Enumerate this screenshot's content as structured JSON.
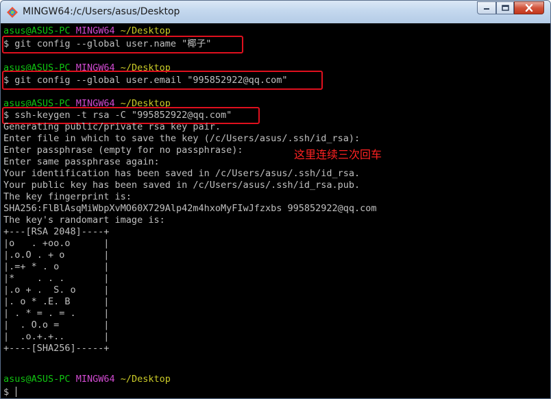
{
  "window": {
    "title": "MINGW64:/c/Users/asus/Desktop",
    "icon": "git-bash-icon",
    "controls": {
      "minimize": "minimize-icon",
      "maximize": "maximize-icon",
      "close": "close-icon"
    }
  },
  "prompt": {
    "user": "asus@ASUS-PC",
    "env": "MINGW64",
    "path": "~/Desktop"
  },
  "commands": [
    "$ git config --global user.name \"椰子\"",
    "$ git config --global user.email \"995852922@qq.com\"",
    "$ ssh-keygen -t rsa -C \"995852922@qq.com\""
  ],
  "output": [
    "Generating public/private rsa key pair.",
    "Enter file in which to save the key (/c/Users/asus/.ssh/id_rsa):",
    "Enter passphrase (empty for no passphrase):",
    "Enter same passphrase again:",
    "Your identification has been saved in /c/Users/asus/.ssh/id_rsa.",
    "Your public key has been saved in /c/Users/asus/.ssh/id_rsa.pub.",
    "The key fingerprint is:",
    "SHA256:FlBlAsqMiWbpXvMO60X729Alp42m4hxoMyFIwJfzxbs 995852922@qq.com",
    "The key's randomart image is:",
    "+---[RSA 2048]----+",
    "|o   . +oo.o      |",
    "|.o.O . + o       |",
    "|.=+ * . o        |",
    "|*    . . .       |",
    "|.o + .  S. o     |",
    "|. o * .E. B      |",
    "| . * = . = .     |",
    "|  . O.o =        |",
    "|  .o.+.+..       |",
    "+----[SHA256]-----+"
  ],
  "annotation": "这里连续三次回车",
  "final_prompt": "$ ",
  "colors": {
    "background": "#000000",
    "text": "#c0c0c0",
    "user": "#11c511",
    "env": "#d04ad0",
    "path": "#cbcb28",
    "highlight": "#e0101e"
  }
}
